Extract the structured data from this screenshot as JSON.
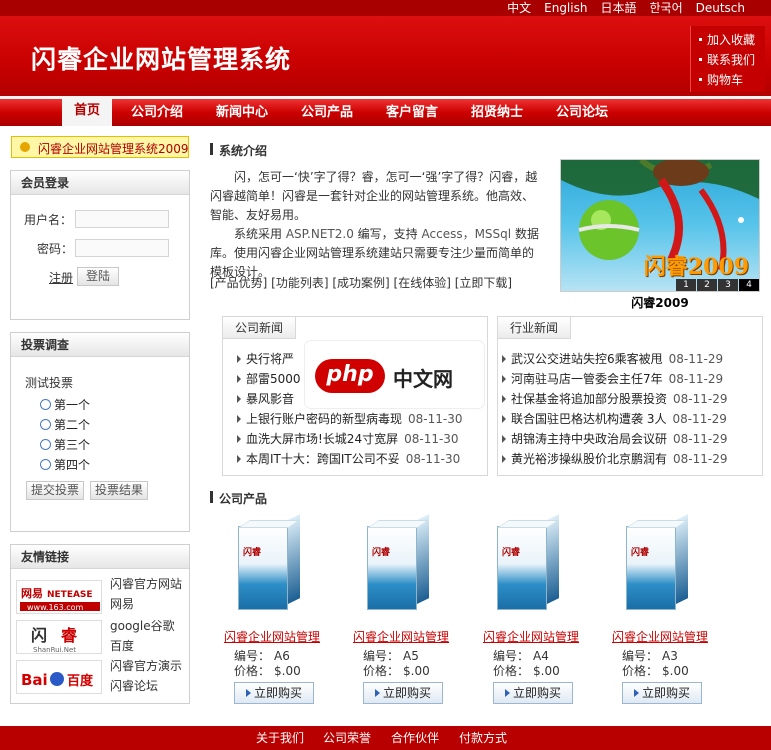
{
  "languages": [
    "中文",
    "English",
    "日本語",
    "한국어",
    "Deutsch"
  ],
  "header": {
    "site_title": "闪睿企业网站管理系统",
    "quick_links": [
      "加入收藏",
      "联系我们",
      "购物车"
    ]
  },
  "nav": [
    "首页",
    "公司介绍",
    "新闻中心",
    "公司产品",
    "客户留言",
    "招贤纳士",
    "公司论坛"
  ],
  "sidebar": {
    "marquee": "闪睿企业网站管理系统2009",
    "login": {
      "title": "会员登录",
      "username_label": "用户名：",
      "password_label": "密码：",
      "register": "注册",
      "login_button": "登陆"
    },
    "vote": {
      "title": "投票调查",
      "question": "测试投票",
      "options": [
        "第一个",
        "第二个",
        "第三个",
        "第四个"
      ],
      "submit": "提交投票",
      "results": "投票结果"
    },
    "friend_links": {
      "title": "友情链接",
      "items": [
        {
          "logo": "网易 NETEASE www.163.com",
          "text1": "闪睿官方网站",
          "text2": "网易"
        },
        {
          "logo": "闪睿 ShanRui.Net",
          "text1": "google谷歌",
          "text2": "百度"
        },
        {
          "logo": "Bai 百度",
          "text1": "闪睿官方演示",
          "text2": "闪睿论坛"
        }
      ]
    }
  },
  "intro": {
    "title": "系统介绍",
    "p1": "闪，怎可一‘快’字了得？睿，怎可一‘强’字了得？闪睿，越闪睿越简单！闪睿是一套针对企业的网站管理系统。他高效、智能、友好易用。",
    "p2_a": "系统采用",
    "p2_b": "ASP.NET2.0",
    "p2_c": "编写，支持",
    "p2_d": "Access，MSSql",
    "p2_e": "数据库。使用闪睿企业网站管理系统建站只需要专注少量而简单的模板设计。",
    "links": "[产品优势] [功能列表] [成功案例] [在线体验] [立即下载]"
  },
  "banner": {
    "overlay": "闪睿2009",
    "pager": [
      "1",
      "2",
      "3",
      "4"
    ],
    "caption": "闪睿2009"
  },
  "company_news": {
    "title": "公司新闻",
    "items": [
      {
        "text": "央行将严",
        "date": ""
      },
      {
        "text": "部雷5000",
        "date": ""
      },
      {
        "text": "暴风影音",
        "date": ""
      },
      {
        "text": "上银行账户密码的新型病毒现",
        "date": "08-11-30"
      },
      {
        "text": "血洗大屏市场!长城24寸宽屏",
        "date": "08-11-30"
      },
      {
        "text": "本周IT十大：跨国IT公司不妥",
        "date": "08-11-30"
      }
    ]
  },
  "industry_news": {
    "title": "行业新闻",
    "items": [
      {
        "text": "武汉公交进站失控6乘客被甩",
        "date": "08-11-29"
      },
      {
        "text": "河南驻马店一管委会主任7年",
        "date": "08-11-29"
      },
      {
        "text": "社保基金将追加部分股票投资",
        "date": "08-11-29"
      },
      {
        "text": "联合国驻巴格达机构遭袭 3人",
        "date": "08-11-29"
      },
      {
        "text": "胡锦涛主持中央政治局会议研",
        "date": "08-11-29"
      },
      {
        "text": "黄光裕涉操纵股价北京鹏润有",
        "date": "08-11-29"
      }
    ]
  },
  "watermark": {
    "php": "php",
    "cn": "中文网"
  },
  "products": {
    "title": "公司产品",
    "items": [
      {
        "name": "闪睿企业网站管理",
        "code_label": "编号：",
        "code": "A6",
        "price_label": "价格：",
        "price": "$.00",
        "buy": "立即购买"
      },
      {
        "name": "闪睿企业网站管理",
        "code_label": "编号：",
        "code": "A5",
        "price_label": "价格：",
        "price": "$.00",
        "buy": "立即购买"
      },
      {
        "name": "闪睿企业网站管理",
        "code_label": "编号：",
        "code": "A4",
        "price_label": "价格：",
        "price": "$.00",
        "buy": "立即购买"
      },
      {
        "name": "闪睿企业网站管理",
        "code_label": "编号：",
        "code": "A3",
        "price_label": "价格：",
        "price": "$.00",
        "buy": "立即购买"
      }
    ]
  },
  "footer": [
    "关于我们",
    "公司荣誉",
    "合作伙伴",
    "付款方式"
  ]
}
